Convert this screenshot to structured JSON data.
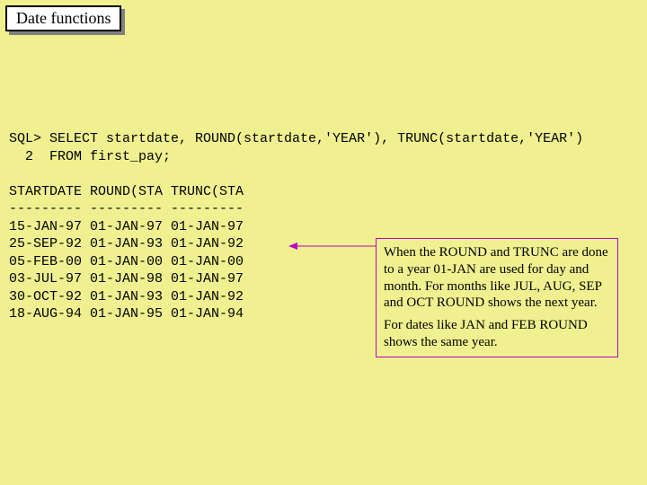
{
  "title": "Date functions",
  "sql": "SQL> SELECT startdate, ROUND(startdate,'YEAR'), TRUNC(startdate,'YEAR')\n  2  FROM first_pay;\n\nSTARTDATE ROUND(STA TRUNC(STA\n--------- --------- ---------\n15-JAN-97 01-JAN-97 01-JAN-97\n25-SEP-92 01-JAN-93 01-JAN-92\n05-FEB-00 01-JAN-00 01-JAN-00\n03-JUL-97 01-JAN-98 01-JAN-97\n30-OCT-92 01-JAN-93 01-JAN-92\n18-AUG-94 01-JAN-95 01-JAN-94",
  "callout": {
    "p1": "When the ROUND and TRUNC are done to a year 01-JAN are used for day and month.  For months like JUL, AUG, SEP and OCT ROUND shows the next year.",
    "p2": "For dates like JAN and FEB ROUND shows the same year."
  }
}
